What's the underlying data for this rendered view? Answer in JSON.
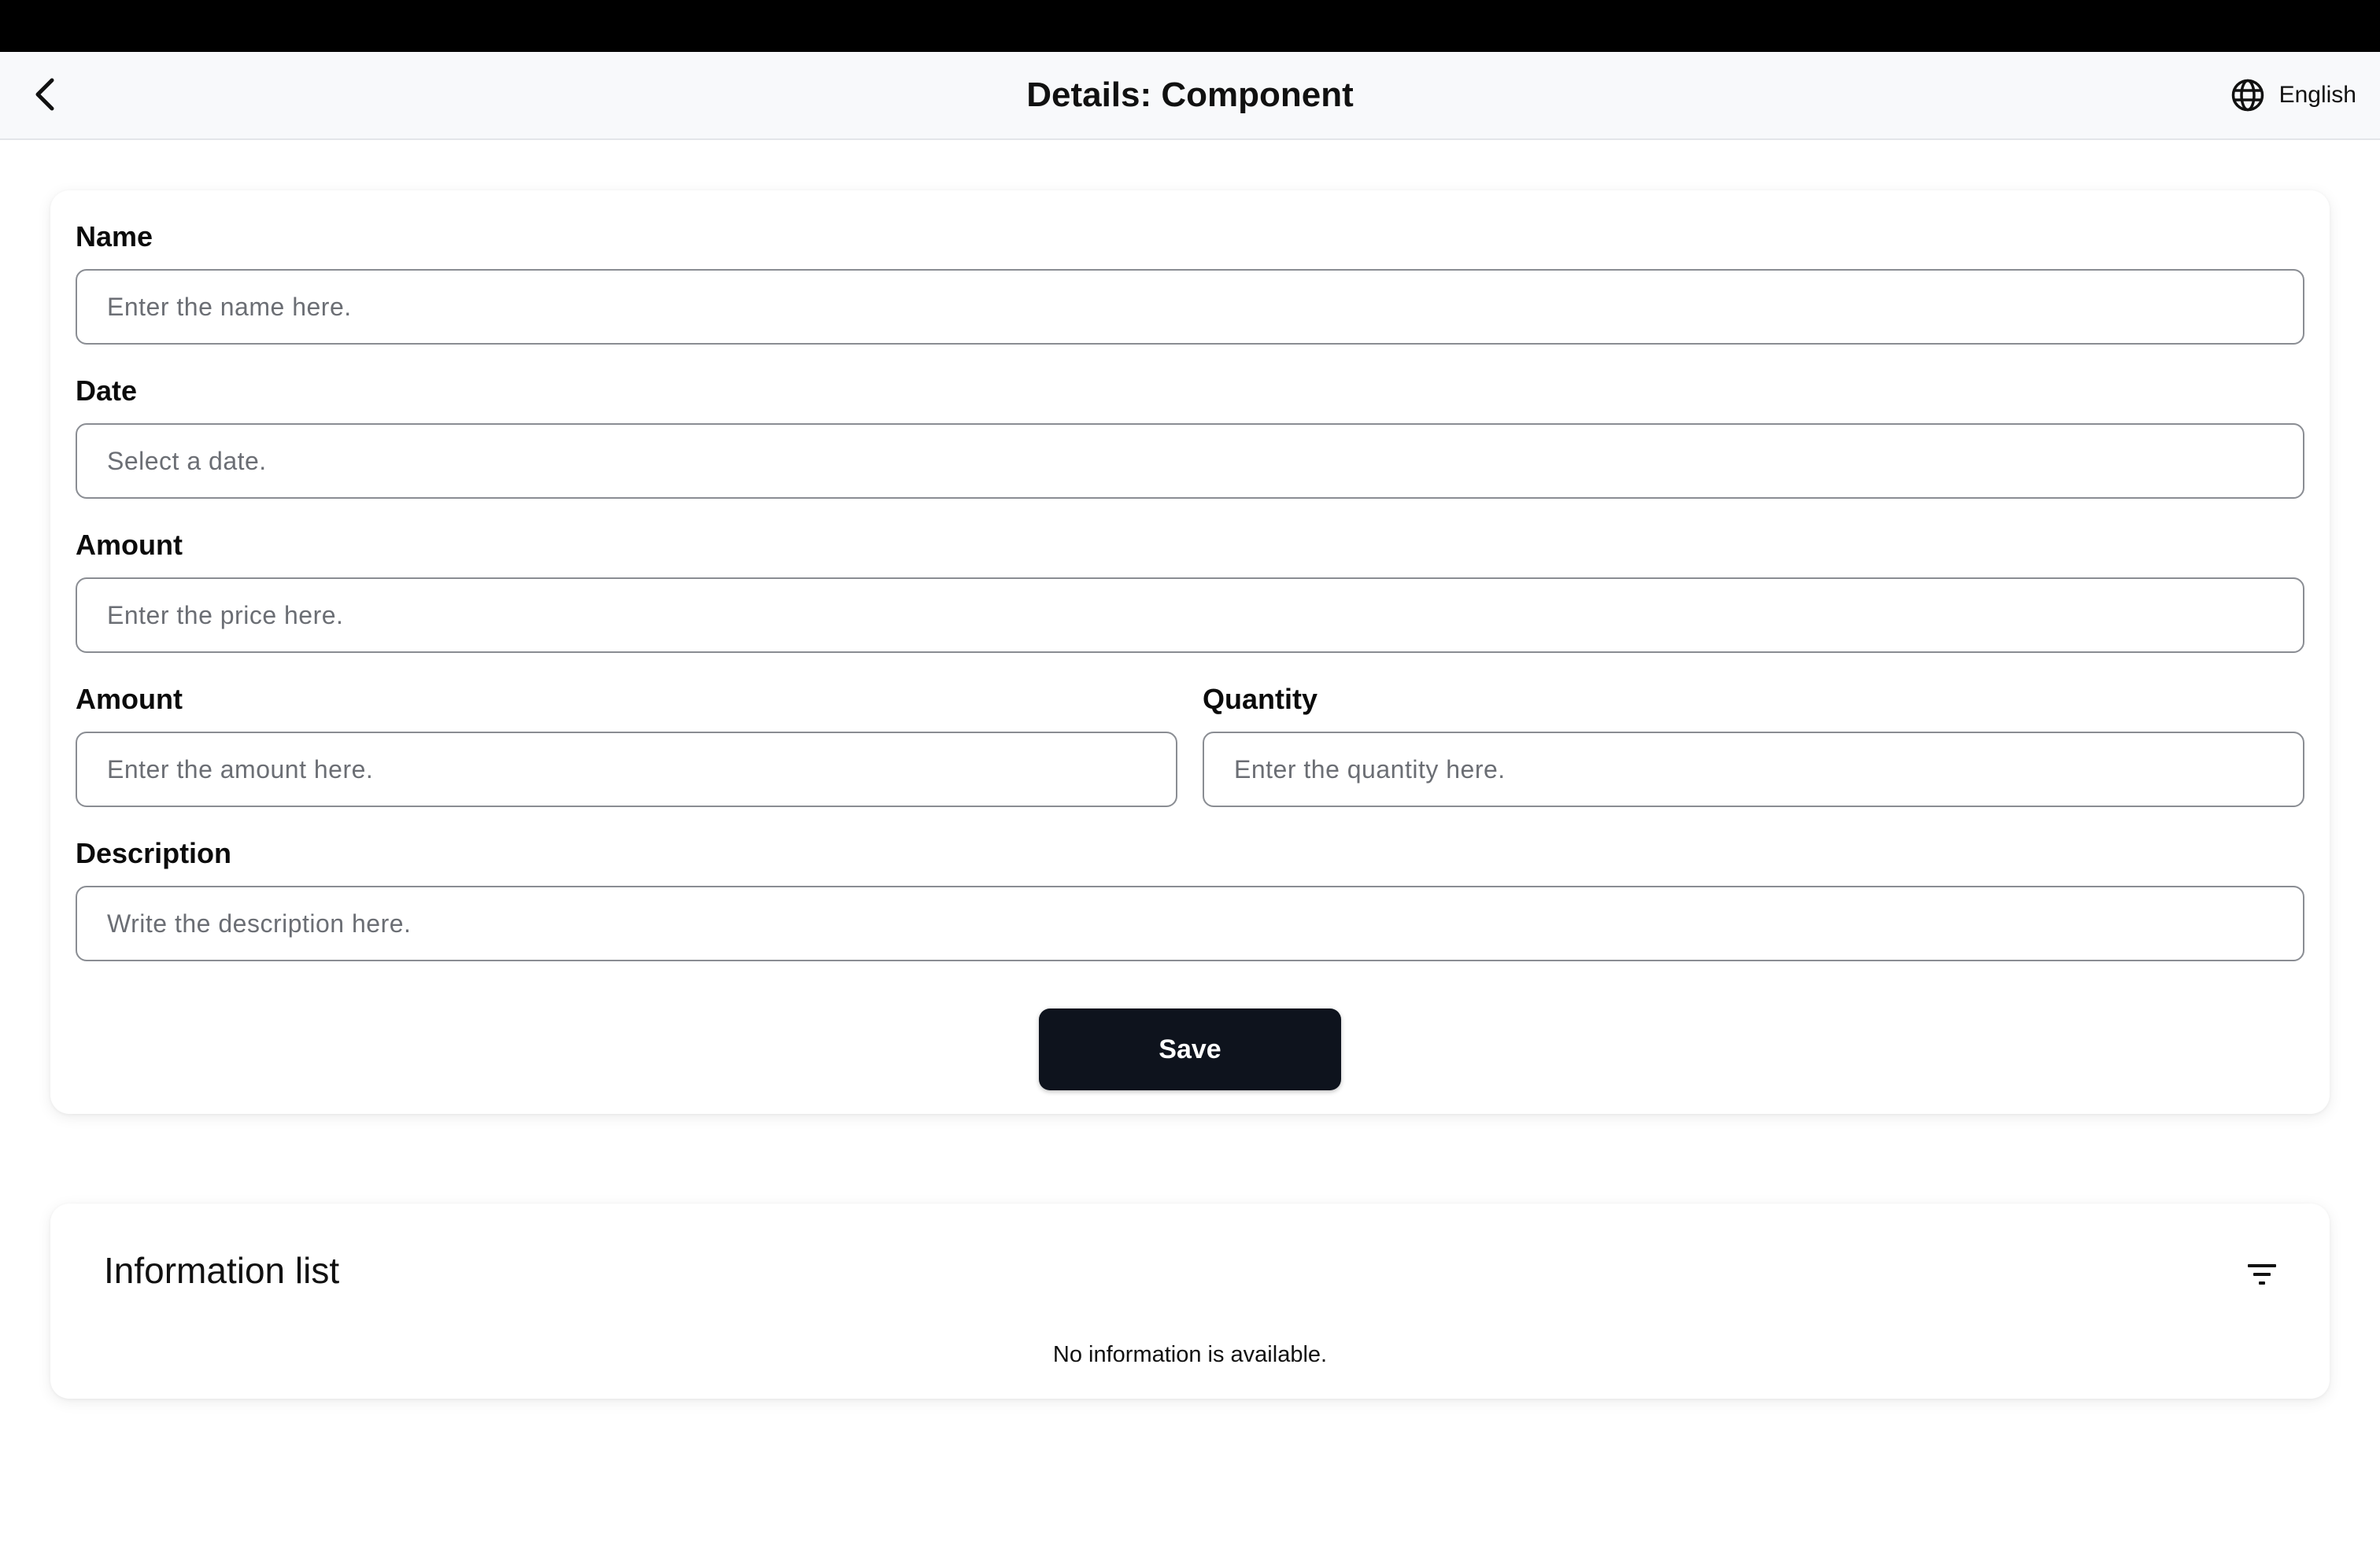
{
  "header": {
    "title": "Details: Component",
    "back_icon": "chevron-left-icon",
    "language_icon": "globe-icon",
    "language_label": "English"
  },
  "form": {
    "name": {
      "label": "Name",
      "value": "",
      "placeholder": "Enter the name here."
    },
    "date": {
      "label": "Date",
      "value": "",
      "placeholder": "Select a date."
    },
    "price": {
      "label": "Amount",
      "value": "",
      "placeholder": "Enter the price here."
    },
    "amount": {
      "label": "Amount",
      "value": "",
      "placeholder": "Enter the amount here."
    },
    "quantity": {
      "label": "Quantity",
      "value": "",
      "placeholder": "Enter the quantity here."
    },
    "description": {
      "label": "Description",
      "value": "",
      "placeholder": "Write the description here."
    },
    "save_label": "Save"
  },
  "info_list": {
    "title": "Information list",
    "filter_icon": "filter-icon",
    "empty_message": "No information is available."
  },
  "colors": {
    "primary_button": "#0e131d",
    "header_background": "#f8f9fb",
    "input_border": "#8a8d93"
  }
}
